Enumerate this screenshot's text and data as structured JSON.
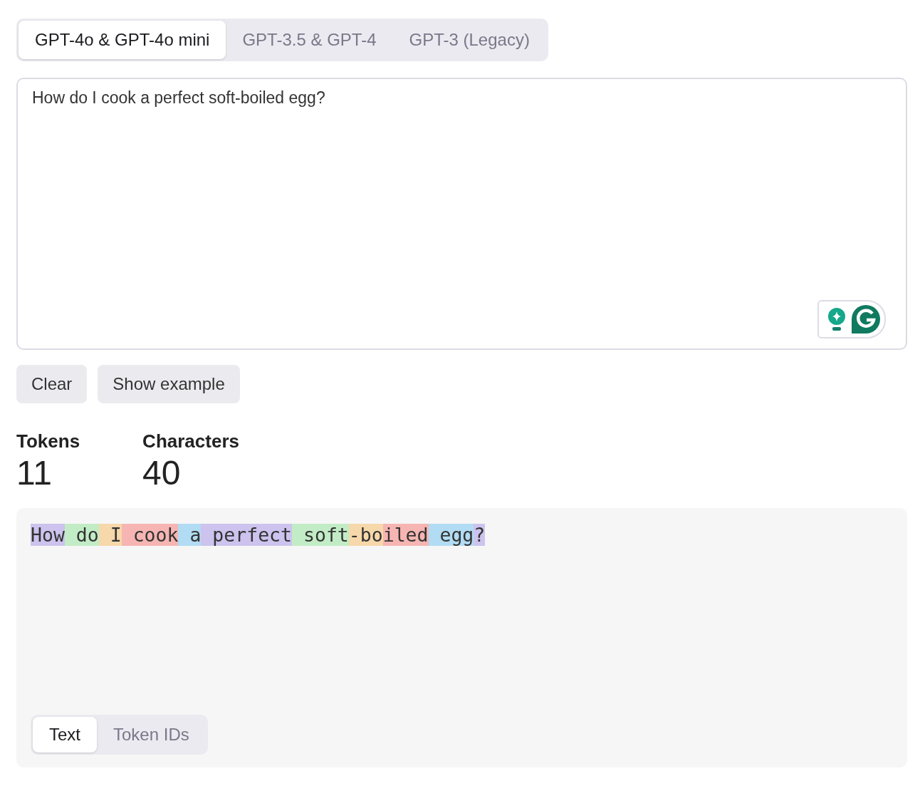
{
  "model_tabs": [
    {
      "label": "GPT-4o & GPT-4o mini",
      "selected": true
    },
    {
      "label": "GPT-3.5 & GPT-4",
      "selected": false
    },
    {
      "label": "GPT-3 (Legacy)",
      "selected": false
    }
  ],
  "input": {
    "value": "How do I cook a perfect soft-boiled egg?"
  },
  "buttons": [
    "Clear",
    "Show example"
  ],
  "stats": [
    {
      "label": "Tokens",
      "value": "11"
    },
    {
      "label": "Characters",
      "value": "40"
    }
  ],
  "tokens": [
    {
      "text": "How",
      "color": "#cdc3ee"
    },
    {
      "text": " do",
      "color": "#c2ecc6"
    },
    {
      "text": " I",
      "color": "#f7d8aa"
    },
    {
      "text": " cook",
      "color": "#f6b5b2"
    },
    {
      "text": " a",
      "color": "#b1dcf3"
    },
    {
      "text": " perfect",
      "color": "#cdc3ee"
    },
    {
      "text": " soft",
      "color": "#c2ecc6"
    },
    {
      "text": "-bo",
      "color": "#f7d8aa"
    },
    {
      "text": "iled",
      "color": "#f6b5b2"
    },
    {
      "text": " egg",
      "color": "#b1dcf3"
    },
    {
      "text": "?",
      "color": "#cdc3ee"
    }
  ],
  "view_tabs": [
    {
      "label": "Text",
      "selected": true
    },
    {
      "label": "Token IDs",
      "selected": false
    }
  ]
}
